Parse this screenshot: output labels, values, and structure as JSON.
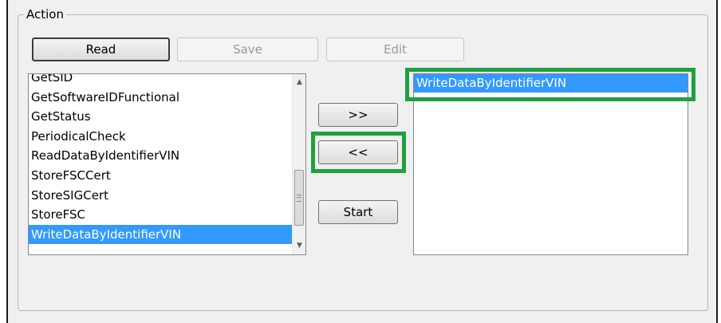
{
  "groupbox": {
    "title": "Action"
  },
  "buttons": {
    "read": "Read",
    "save": "Save",
    "edit": "Edit",
    "add": ">>",
    "remove": "<<",
    "start": "Start"
  },
  "available_list": {
    "items": [
      "GetSID",
      "GetSoftwareIDFunctional",
      "GetStatus",
      "PeriodicalCheck",
      "ReadDataByIdentifierVIN",
      "StoreFSCCert",
      "StoreSIGCert",
      "StoreFSC",
      "WriteDataByIdentifierVIN"
    ],
    "selected": "WriteDataByIdentifierVIN"
  },
  "selected_list": {
    "items": [
      "WriteDataByIdentifierVIN"
    ]
  },
  "colors": {
    "highlight_box": "#20a040",
    "selection": "#3399ff"
  }
}
